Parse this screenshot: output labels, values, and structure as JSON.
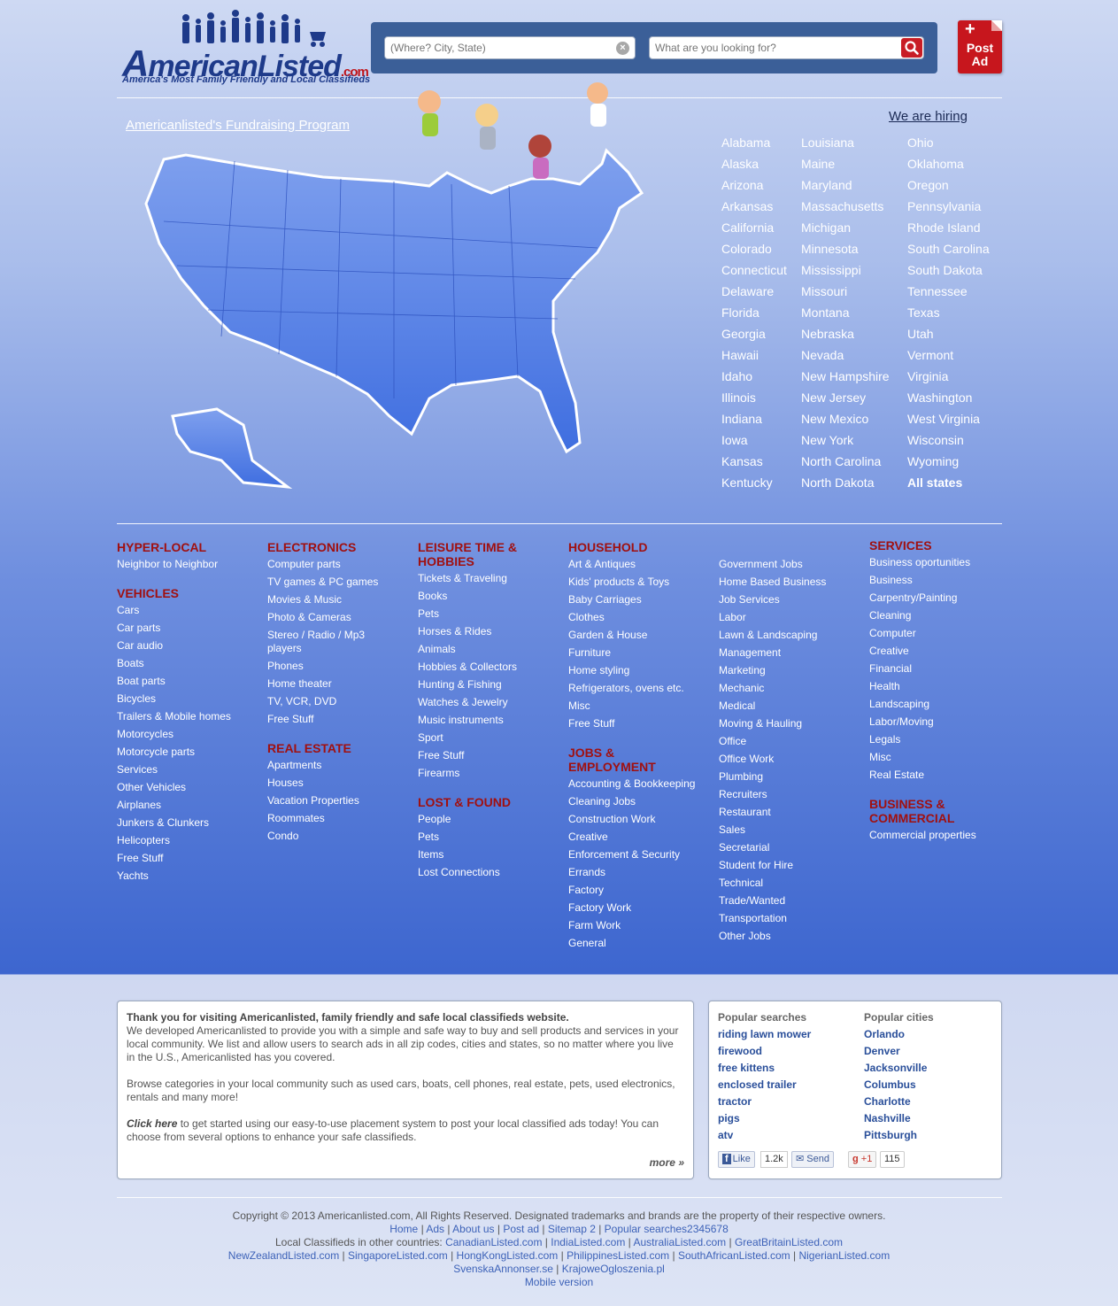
{
  "header": {
    "logo_brand_big": "A",
    "logo_brand_rest": "mericanListed",
    "logo_brand_com": ".com",
    "logo_tagline": "America's Most Family Friendly and Local Classifieds",
    "where_placeholder": "(Where? City, State)",
    "what_placeholder": "What are you looking for?",
    "post_ad_label_1": "Post",
    "post_ad_label_2": "Ad"
  },
  "links": {
    "fundraising": "Americanlisted's Fundraising Program",
    "hiring": "We are hiring"
  },
  "states": {
    "col1": [
      "Alabama",
      "Alaska",
      "Arizona",
      "Arkansas",
      "California",
      "Colorado",
      "Connecticut",
      "Delaware",
      "Florida",
      "Georgia",
      "Hawaii",
      "Idaho",
      "Illinois",
      "Indiana",
      "Iowa",
      "Kansas",
      "Kentucky"
    ],
    "col2": [
      "Louisiana",
      "Maine",
      "Maryland",
      "Massachusetts",
      "Michigan",
      "Minnesota",
      "Mississippi",
      "Missouri",
      "Montana",
      "Nebraska",
      "Nevada",
      "New Hampshire",
      "New Jersey",
      "New Mexico",
      "New York",
      "North Carolina",
      "North Dakota"
    ],
    "col3": [
      "Ohio",
      "Oklahoma",
      "Oregon",
      "Pennsylvania",
      "Rhode Island",
      "South Carolina",
      "South Dakota",
      "Tennessee",
      "Texas",
      "Utah",
      "Vermont",
      "Virginia",
      "Washington",
      "West Virginia",
      "Wisconsin",
      "Wyoming"
    ],
    "all_states": "All states"
  },
  "categories": {
    "hyperlocal": {
      "title": "HYPER-LOCAL",
      "items": [
        "Neighbor to Neighbor"
      ]
    },
    "vehicles": {
      "title": "VEHICLES",
      "items": [
        "Cars",
        "Car parts",
        "Car audio",
        "Boats",
        "Boat parts",
        "Bicycles",
        "Trailers & Mobile homes",
        "Motorcycles",
        "Motorcycle parts",
        "Services",
        "Other Vehicles",
        "Airplanes",
        "Junkers & Clunkers",
        "Helicopters",
        "Free Stuff",
        "Yachts"
      ]
    },
    "electronics": {
      "title": "ELECTRONICS",
      "items": [
        "Computer parts",
        "TV games & PC games",
        "Movies & Music",
        "Photo & Cameras",
        "Stereo / Radio / Mp3 players",
        "Phones",
        "Home theater",
        "TV, VCR, DVD",
        "Free Stuff"
      ]
    },
    "realestate": {
      "title": "REAL ESTATE",
      "items": [
        "Apartments",
        "Houses",
        "Vacation Properties",
        "Roommates",
        "Condo"
      ]
    },
    "leisure": {
      "title": "LEISURE TIME & HOBBIES",
      "items": [
        "Tickets & Traveling",
        "Books",
        "Pets",
        "Horses & Rides",
        "Animals",
        "Hobbies & Collectors",
        "Hunting & Fishing",
        "Watches & Jewelry",
        "Music instruments",
        "Sport",
        "Free Stuff",
        "Firearms"
      ]
    },
    "lostfound": {
      "title": "LOST & FOUND",
      "items": [
        "People",
        "Pets",
        "Items",
        "Lost Connections"
      ]
    },
    "household": {
      "title": "HOUSEHOLD",
      "items": [
        "Art & Antiques",
        "Kids' products & Toys",
        "Baby Carriages",
        "Clothes",
        "Garden & House",
        "Furniture",
        "Home styling",
        "Refrigerators, ovens etc.",
        "Misc",
        "Free Stuff"
      ]
    },
    "jobs": {
      "title": "JOBS & EMPLOYMENT",
      "items": [
        "Accounting & Bookkeeping",
        "Cleaning Jobs",
        "Construction Work",
        "Creative",
        "Enforcement & Security",
        "Errands",
        "Factory",
        "Factory Work",
        "Farm Work",
        "General"
      ]
    },
    "jobs2": {
      "items": [
        "Government Jobs",
        "Home Based Business",
        "Job Services",
        "Labor",
        "Lawn & Landscaping",
        "Management",
        "Marketing",
        "Mechanic",
        "Medical",
        "Moving & Hauling",
        "Office",
        "Office Work",
        "Plumbing",
        "Recruiters",
        "Restaurant",
        "Sales",
        "Secretarial",
        "Student for Hire",
        "Technical",
        "Trade/Wanted",
        "Transportation",
        "Other Jobs"
      ]
    },
    "services": {
      "title": "SERVICES",
      "items": [
        "Business oportunities",
        "Business",
        "Carpentry/Painting",
        "Cleaning",
        "Computer",
        "Creative",
        "Financial",
        "Health",
        "Landscaping",
        "Labor/Moving",
        "Legals",
        "Misc",
        "Real Estate"
      ]
    },
    "business": {
      "title": "BUSINESS & COMMERCIAL",
      "items": [
        "Commercial properties"
      ]
    }
  },
  "about": {
    "heading": "Thank you for visiting Americanlisted, family friendly and safe local classifieds website.",
    "p1": "We developed Americanlisted to provide you with a simple and safe way to buy and sell products and services in your local community. We list and allow users to search ads in all zip codes, cities and states, so no matter where you live in the U.S., Americanlisted has you covered.",
    "p2": "Browse categories in your local community such as used cars, boats, cell phones, real estate, pets, used electronics, rentals and many more!",
    "click_here": "Click here",
    "p3_rest": " to get started using our easy-to-use placement system to post your local classified ads today! You can choose from several options to enhance your safe classifieds.",
    "more": "more »"
  },
  "popular": {
    "searches_title": "Popular searches",
    "searches": [
      "riding lawn mower",
      "firewood",
      "free kittens",
      "enclosed trailer",
      "tractor",
      "pigs",
      "atv"
    ],
    "cities_title": "Popular cities",
    "cities": [
      "Orlando",
      "Denver",
      "Jacksonville",
      "Columbus",
      "Charlotte",
      "Nashville",
      "Pittsburgh"
    ],
    "fb_like": "Like",
    "fb_count": "1.2k",
    "fb_send": "Send",
    "gplus": "+1",
    "gplus_count": "115"
  },
  "footer": {
    "copyright": "Copyright © 2013 Americanlisted.com, All Rights Reserved. Designated trademarks and brands are the property of their respective owners.",
    "nav": [
      "Home",
      "Ads",
      "About us",
      "Post ad",
      "Sitemap 2",
      "Popular searches2345678"
    ],
    "other_countries_label": "Local Classifieds in other countries: ",
    "countries_row1": [
      "CanadianListed.com",
      "IndiaListed.com",
      "AustraliaListed.com",
      "GreatBritainListed.com"
    ],
    "countries_row2": [
      "NewZealandListed.com",
      "SingaporeListed.com",
      "HongKongListed.com",
      "PhilippinesListed.com",
      "SouthAfricanListed.com",
      "NigerianListed.com"
    ],
    "countries_row3": [
      "SvenskaAnnonser.se",
      "KrajoweOgloszenia.pl"
    ],
    "mobile": "Mobile version"
  },
  "colors": {
    "accent_red": "#c81d25",
    "category_title": "#a01010",
    "header_bar": "#3b5f98",
    "link_blue": "#2a4f9a"
  }
}
